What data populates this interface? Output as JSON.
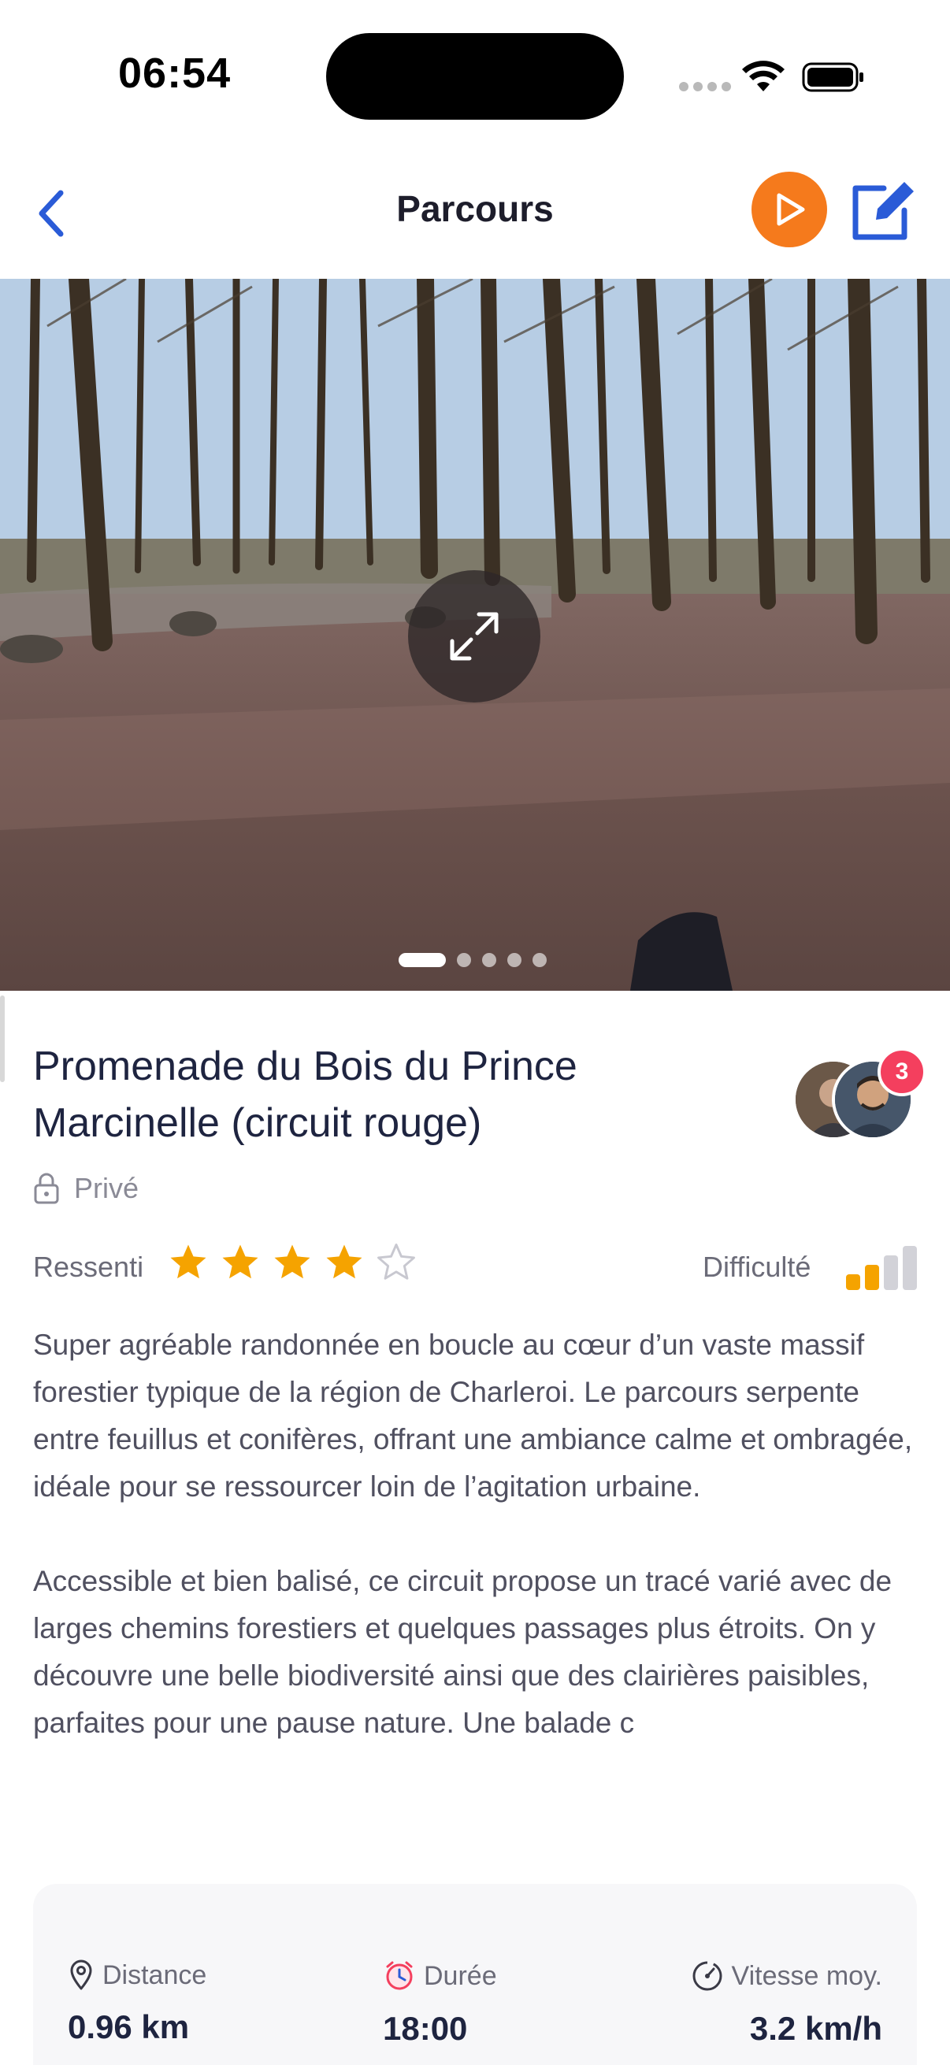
{
  "status_bar": {
    "time": "06:54"
  },
  "nav": {
    "title": "Parcours",
    "back_icon": "chevron-left-icon",
    "play_icon": "play-icon",
    "edit_icon": "edit-icon"
  },
  "hero": {
    "expand_icon": "expand-icon",
    "page_count": 5,
    "current_page": 1
  },
  "route": {
    "title": "Promenade du Bois du Prince Marcinelle (circuit rouge)",
    "participants_badge": "3",
    "privacy_label": "Privé",
    "rating_label": "Ressenti",
    "rating": 4,
    "rating_max": 5,
    "difficulty_label": "Difficulté",
    "difficulty_level": 2,
    "difficulty_max": 4,
    "description_p1": "Super agréable randonnée en boucle au cœur d’un vaste massif forestier typique de la région de Charleroi. Le parcours serpente entre feuillus et conifères, offrant une ambiance calme et ombragée, idéale pour se ressourcer loin de l’agitation urbaine.",
    "description_p2": "Accessible et bien balisé, ce circuit propose un tracé varié avec de larges chemins forestiers et quelques passages plus étroits. On y découvre une belle biodiversité ainsi que des clairières paisibles, parfaites pour une pause nature. Une balade c"
  },
  "stats": {
    "distance_label": "Distance",
    "distance_value": "0.96 km",
    "duration_label": "Durée",
    "duration_value": "18:00",
    "speed_label": "Vitesse moy.",
    "speed_value": "3.2 km/h"
  },
  "colors": {
    "accent_orange": "#f57a1c",
    "accent_blue": "#2a5bd7",
    "star_gold": "#f5a300",
    "badge_red": "#f43f5e",
    "title_dark": "#1e2440"
  }
}
